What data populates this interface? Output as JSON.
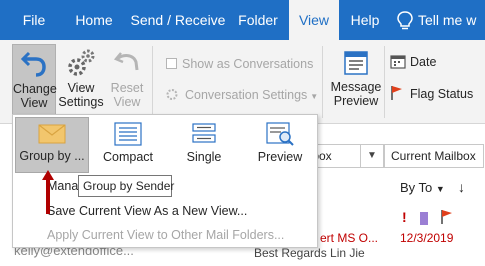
{
  "menu": {
    "tabs": [
      "File",
      "Home",
      "Send / Receive",
      "Folder",
      "View",
      "Help"
    ],
    "active_tab": "View",
    "tell_me": "Tell me w"
  },
  "ribbon": {
    "change_view": "Change View",
    "view_settings": "View Settings",
    "reset_view": "Reset View",
    "show_as_conversations": "Show as Conversations",
    "conversation_settings": "Conversation Settings",
    "message_preview": "Message Preview",
    "date": "Date",
    "flag_status": "Flag Status"
  },
  "gallery": {
    "items": [
      "Group by ...",
      "Compact",
      "Single",
      "Preview"
    ]
  },
  "menu_items": {
    "manage": "Mana",
    "save_view": "Save Current View As a New View...",
    "apply_view": "Apply Current View to Other Mail Folders..."
  },
  "tooltip": "Group by Sender",
  "background": {
    "search_box_left": "ilbox",
    "search_box_right": "Current Mailbox",
    "sort_label": "By To",
    "mail_subject_fragment": "ert MS O...",
    "mail_date": "12/3/2019",
    "mail_preview": "Best Regards  Lin Jie",
    "account_fragment": "kelly@extendoffice..."
  },
  "colors": {
    "accent": "#1f6fc5",
    "selection": "#c5c5c5",
    "alert": "#c00000"
  }
}
